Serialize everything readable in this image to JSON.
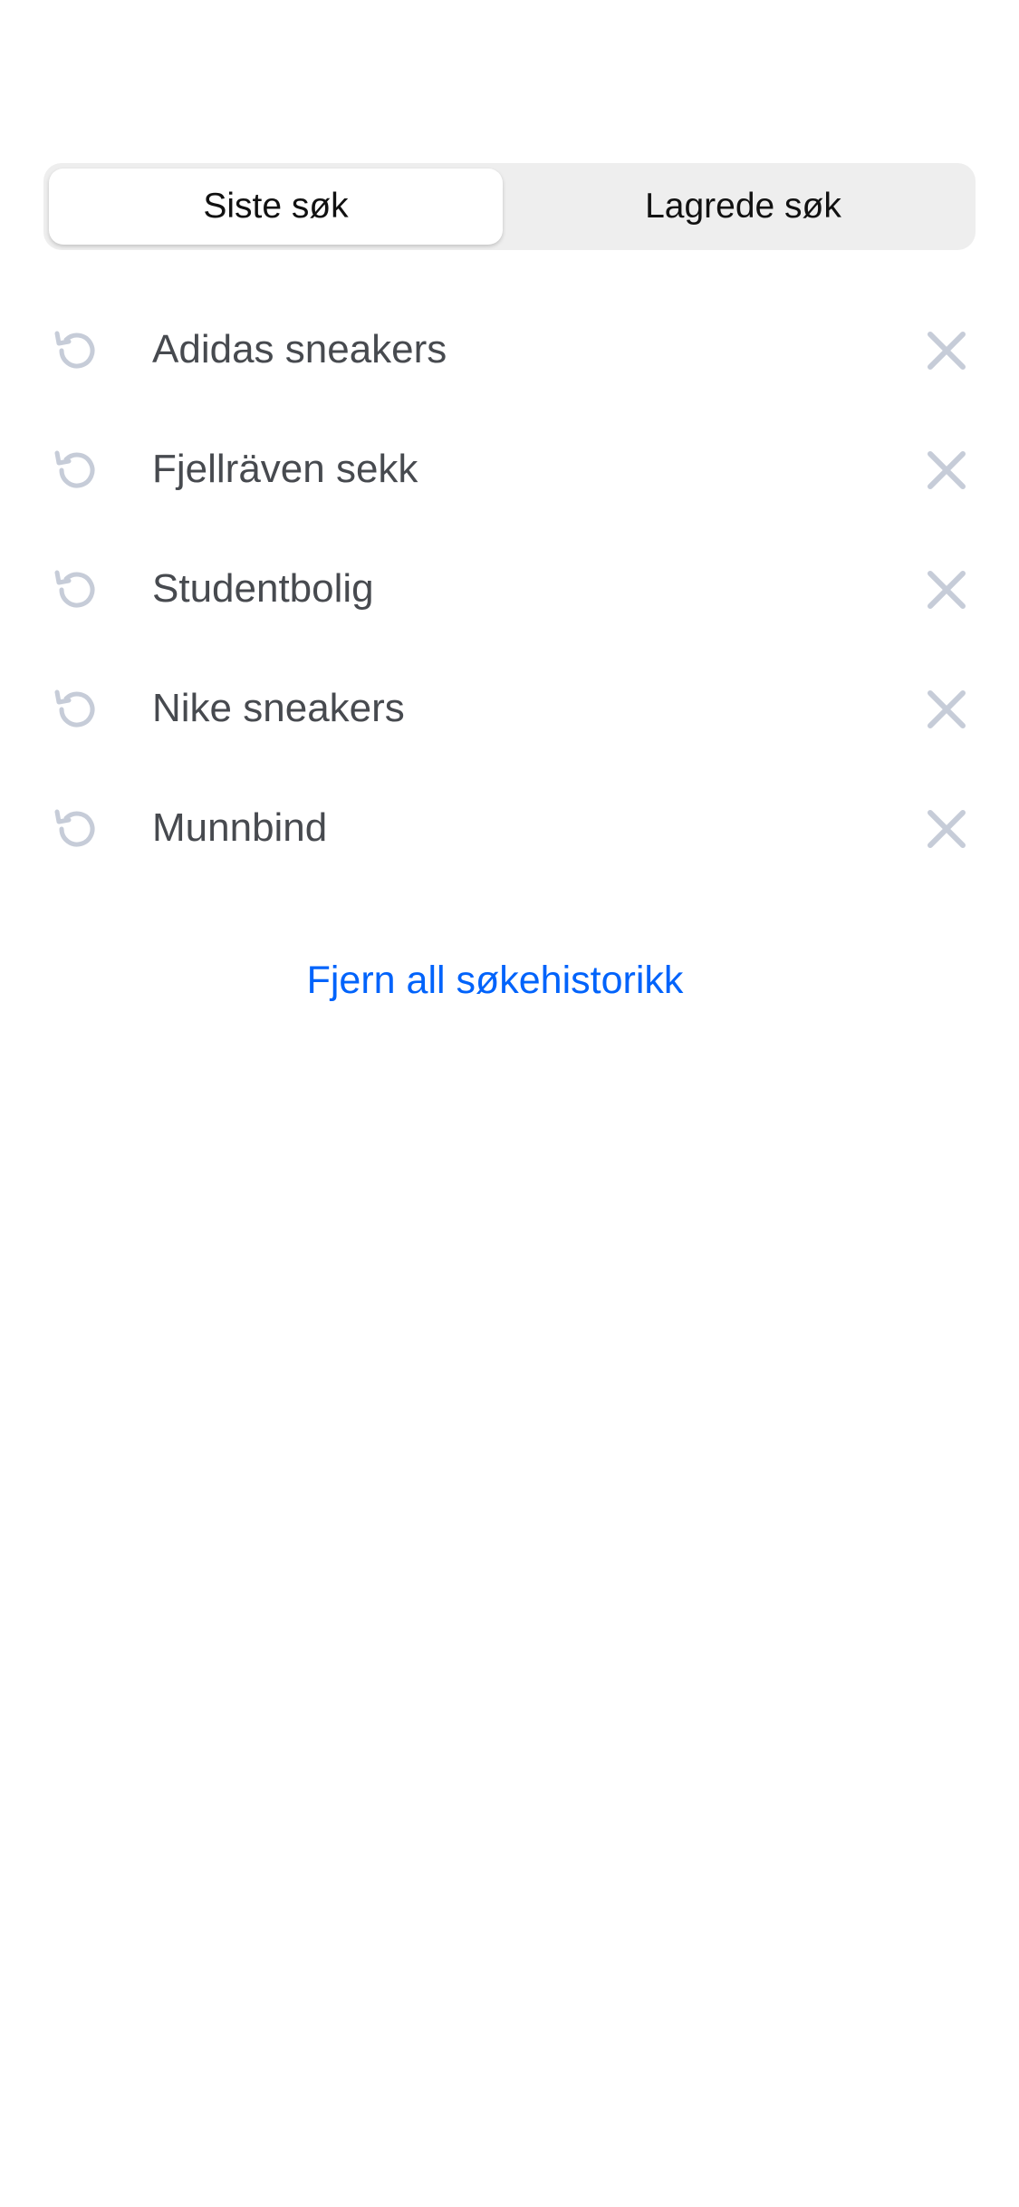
{
  "tabs": {
    "recent_label": "Siste søk",
    "saved_label": "Lagrede søk",
    "active": "recent"
  },
  "history": {
    "items": [
      {
        "label": "Adidas sneakers",
        "icon": "history-icon",
        "remove_icon": "close-icon"
      },
      {
        "label": "Fjellräven sekk",
        "icon": "history-icon",
        "remove_icon": "close-icon"
      },
      {
        "label": "Studentbolig",
        "icon": "history-icon",
        "remove_icon": "close-icon"
      },
      {
        "label": "Nike sneakers",
        "icon": "history-icon",
        "remove_icon": "close-icon"
      },
      {
        "label": "Munnbind",
        "icon": "history-icon",
        "remove_icon": "close-icon"
      }
    ]
  },
  "clear_all_label": "Fjern all søkehistorikk",
  "colors": {
    "link": "#0063fb",
    "icon": "#c6ccd8",
    "text": "#474a4f",
    "segment_bg": "#eeeeee"
  }
}
